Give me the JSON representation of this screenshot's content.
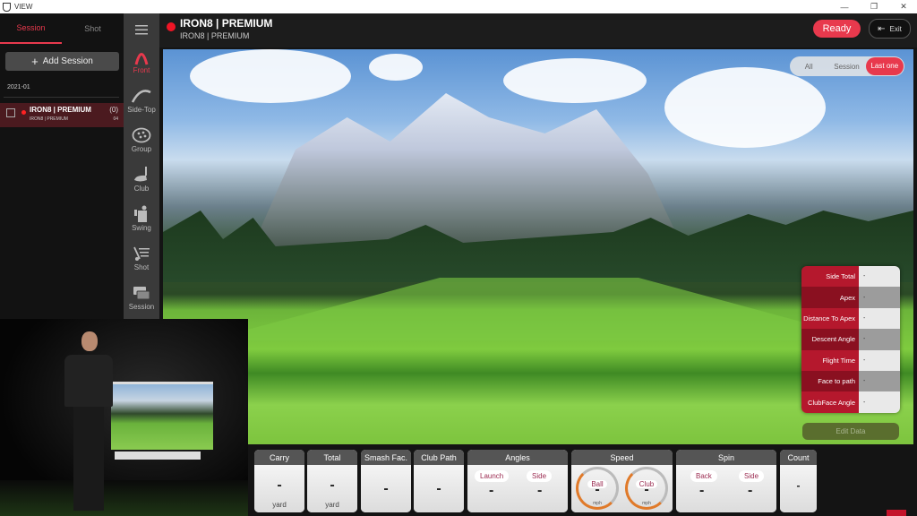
{
  "window": {
    "title": "VIEW",
    "controls": [
      "minimize",
      "restore",
      "close"
    ]
  },
  "left_panel": {
    "tabs": [
      {
        "label": "Session",
        "active": true
      },
      {
        "label": "Shot",
        "active": false
      }
    ],
    "add_session_label": "Add Session",
    "date_group": "2021-01",
    "sessions": [
      {
        "name": "IRON8 | PREMIUM",
        "sub": "IRON8 | PREMIUM",
        "count": "(0)",
        "number": "04",
        "selected": true
      }
    ]
  },
  "rail": {
    "items": [
      {
        "label": "Front",
        "icon": "trajectory-front-icon",
        "active": true
      },
      {
        "label": "Side-Top",
        "icon": "trajectory-side-icon",
        "active": false
      },
      {
        "label": "Group",
        "icon": "group-icon",
        "active": false
      },
      {
        "label": "Club",
        "icon": "club-icon",
        "active": false
      },
      {
        "label": "Swing",
        "icon": "swing-icon",
        "active": false
      },
      {
        "label": "Shot",
        "icon": "shot-list-icon",
        "active": false
      },
      {
        "label": "Session",
        "icon": "session-icon",
        "active": false
      }
    ]
  },
  "header": {
    "title": "IRON8 | PREMIUM",
    "subtitle": "IRON8 | PREMIUM",
    "ready_label": "Ready",
    "exit_label": "Exit"
  },
  "filter": {
    "options": [
      "All",
      "Session",
      "Last one"
    ],
    "selected": "Last one"
  },
  "stats_panel": {
    "rows": [
      {
        "label": "Side Total",
        "value": "-"
      },
      {
        "label": "Apex",
        "value": "-"
      },
      {
        "label": "Distance To Apex",
        "value": "-"
      },
      {
        "label": "Descent Angle",
        "value": "-"
      },
      {
        "label": "Flight Time",
        "value": "-"
      },
      {
        "label": "Face to path",
        "value": "-"
      },
      {
        "label": "ClubFace Angle",
        "value": "-"
      }
    ],
    "edit_label": "Edit Data"
  },
  "metrics": {
    "carry": {
      "label": "Carry",
      "value": "-",
      "unit": "yard"
    },
    "total": {
      "label": "Total",
      "value": "-",
      "unit": "yard"
    },
    "smash": {
      "label": "Smash Fac.",
      "value": "-"
    },
    "club_path": {
      "label": "Club Path",
      "value": "-"
    },
    "angles": {
      "label": "Angles",
      "launch_label": "Launch",
      "launch_value": "-",
      "side_label": "Side",
      "side_value": "-"
    },
    "speed": {
      "label": "Speed",
      "ball_label": "Ball",
      "ball_value": "-",
      "ball_unit": "mph",
      "club_label": "Club",
      "club_value": "-",
      "club_unit": "mph"
    },
    "spin": {
      "label": "Spin",
      "back_label": "Back",
      "back_value": "-",
      "side_label": "Side",
      "side_value": "-"
    },
    "count": {
      "label": "Count",
      "value": "-"
    }
  },
  "colors": {
    "accent": "#e8394d",
    "record": "#f01525",
    "panel_red": "#b5182d",
    "panel_dark_red": "#8a1020"
  }
}
